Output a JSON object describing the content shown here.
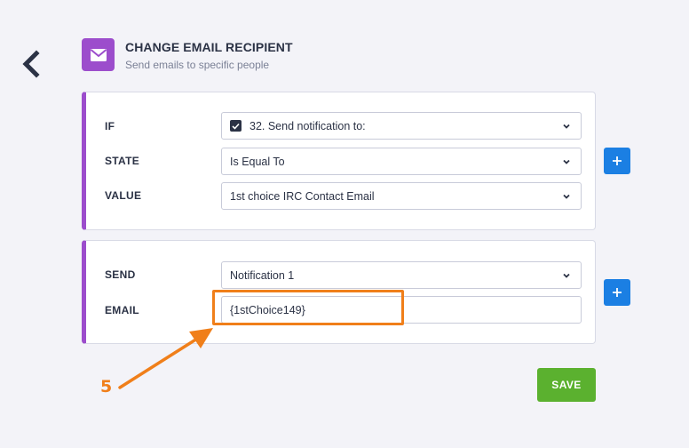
{
  "header": {
    "title": "CHANGE EMAIL RECIPIENT",
    "subtitle": "Send emails to specific people",
    "icon": "envelope-icon",
    "accent": "#9c4dcc"
  },
  "condition": {
    "if_label": "IF",
    "if_value": "32. Send notification to:",
    "state_label": "STATE",
    "state_value": "Is Equal To",
    "value_label": "VALUE",
    "value_value": "1st choice IRC Contact Email"
  },
  "action": {
    "send_label": "SEND",
    "send_value": "Notification 1",
    "email_label": "EMAIL",
    "email_value": "{1stChoice149}"
  },
  "buttons": {
    "save": "SAVE",
    "add": "+"
  },
  "annotation": {
    "step": "5",
    "color": "#f07f1a"
  },
  "colors": {
    "primary": "#1b7fe3",
    "save": "#5bb12f"
  }
}
